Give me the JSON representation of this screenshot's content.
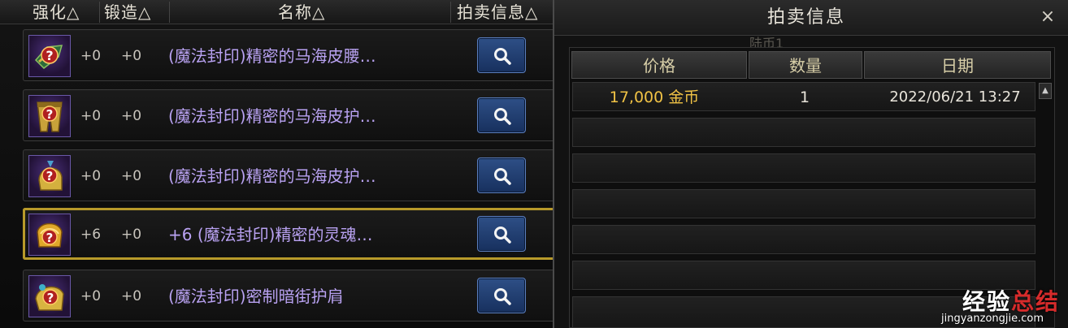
{
  "columns": {
    "enhance": "强化△",
    "forge": "锻造△",
    "name": "名称△",
    "auction_info": "拍卖信息△"
  },
  "items": [
    {
      "enhance": "+0",
      "forge": "+0",
      "name": "(魔法封印)精密的马海皮腰…",
      "icon": "belt-icon"
    },
    {
      "enhance": "+0",
      "forge": "+0",
      "name": "(魔法封印)精密的马海皮护…",
      "icon": "leg-armor-icon"
    },
    {
      "enhance": "+0",
      "forge": "+0",
      "name": "(魔法封印)精密的马海皮护…",
      "icon": "helmet-icon"
    },
    {
      "enhance": "+6",
      "forge": "+0",
      "name": "+6 (魔法封印)精密的灵魂…",
      "icon": "shoulder-icon",
      "selected": true
    },
    {
      "enhance": "+0",
      "forge": "+0",
      "name": "(魔法封印)密制暗街护肩",
      "icon": "shoulder-pad-icon"
    }
  ],
  "auction": {
    "title": "拍卖信息",
    "close_label": "×",
    "background_text": "陆币1",
    "headers": {
      "price": "价格",
      "quantity": "数量",
      "date": "日期"
    },
    "rows": [
      {
        "price": "17,000 金币",
        "quantity": "1",
        "date": "2022/06/21 13:27"
      }
    ]
  },
  "colors": {
    "item_name": "#b9a2f2",
    "price": "#f0c245",
    "selected_border": "#b89a2a",
    "search_button": "#2e4f86"
  },
  "watermark": {
    "part1": "经验",
    "part2": "总结",
    "url": "jingyanzongjie.com"
  }
}
